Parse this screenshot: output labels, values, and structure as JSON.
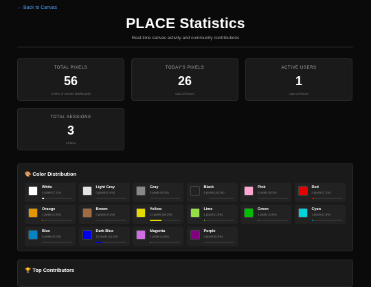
{
  "nav": {
    "back_label": "← Back to Canvas"
  },
  "header": {
    "title": "PLACE Statistics",
    "subtitle": "Real-time canvas activity and community contributions"
  },
  "stats": [
    {
      "label": "TOTAL PIXELS",
      "value": "56",
      "sub": "0.09% of canvas (56/65,536)"
    },
    {
      "label": "TODAY'S PIXELS",
      "value": "26",
      "sub": "Last 24 hours"
    },
    {
      "label": "ACTIVE USERS",
      "value": "1",
      "sub": "Last 24 hours"
    },
    {
      "label": "TOTAL SESSIONS",
      "value": "3",
      "sub": "All time"
    }
  ],
  "color_distribution": {
    "icon": "palette-icon",
    "heading": "🎨 Color Distribution",
    "colors": [
      {
        "name": "White",
        "stat": "4 pixels (7.1%)",
        "hex": "#ffffff",
        "pct": 7.1
      },
      {
        "name": "Light Gray",
        "stat": "0 pixels (0.0%)",
        "hex": "#e4e4e4",
        "pct": 0
      },
      {
        "name": "Gray",
        "stat": "0 pixels (0.0%)",
        "hex": "#888888",
        "pct": 0
      },
      {
        "name": "Black",
        "stat": "9 pixels (16.1%)",
        "hex": "#222222",
        "pct": 16.1
      },
      {
        "name": "Pink",
        "stat": "0 pixels (0.0%)",
        "hex": "#ffa7d1",
        "pct": 0
      },
      {
        "name": "Red",
        "stat": "4 pixels (7.1%)",
        "hex": "#e50000",
        "pct": 7.1
      },
      {
        "name": "Orange",
        "stat": "1 pixels (1.8%)",
        "hex": "#e59500",
        "pct": 1.8
      },
      {
        "name": "Brown",
        "stat": "0 pixels (0.0%)",
        "hex": "#a06a42",
        "pct": 0
      },
      {
        "name": "Yellow",
        "stat": "22 pixels (39.3%)",
        "hex": "#e5d900",
        "pct": 39.3
      },
      {
        "name": "Lime",
        "stat": "1 pixels (1.8%)",
        "hex": "#94e044",
        "pct": 1.8
      },
      {
        "name": "Green",
        "stat": "1 pixels (1.8%)",
        "hex": "#02be01",
        "pct": 1.8
      },
      {
        "name": "Cyan",
        "stat": "1 pixels (1.8%)",
        "hex": "#00d3dd",
        "pct": 1.8
      },
      {
        "name": "Blue",
        "stat": "0 pixels (0.0%)",
        "hex": "#0083c7",
        "pct": 0
      },
      {
        "name": "Dark Blue",
        "stat": "12 pixels (21.4%)",
        "hex": "#0000ea",
        "pct": 21.4
      },
      {
        "name": "Magenta",
        "stat": "1 pixels (1.8%)",
        "hex": "#cf6ee4",
        "pct": 1.8
      },
      {
        "name": "Purple",
        "stat": "0 pixels (0.0%)",
        "hex": "#820080",
        "pct": 0
      }
    ]
  },
  "top_contributors": {
    "icon": "trophy-icon",
    "heading": "🏆 Top Contributors"
  },
  "theme": {
    "accent": "#4a9eff",
    "bar_fill": "#4a9eff"
  }
}
